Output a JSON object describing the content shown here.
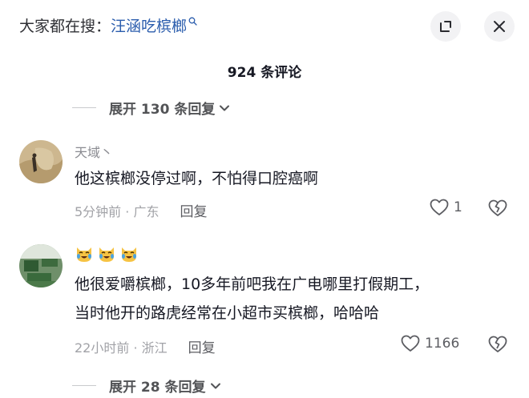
{
  "header": {
    "search_prefix": "大家都在搜：",
    "search_keyword": "汪涵吃槟榔"
  },
  "comments_title": "924 条评论",
  "thread1_expand": "展开 130 条回复",
  "comments": [
    {
      "author": "天域丶",
      "text": "他这槟榔没停过啊，不怕得口腔癌啊",
      "time_location": "5分钟前 · 广东",
      "reply_label": "回复",
      "likes": "1"
    },
    {
      "author_emojis": "😹😹😹",
      "text_line1": "他很爱嚼槟榔，10多年前吧我在广电哪里打假期工，",
      "text_line2": "当时他开的路虎经常在小超市买槟榔，哈哈哈",
      "time_location": "22小时前 · 浙江",
      "reply_label": "回复",
      "likes": "1166"
    }
  ],
  "thread2_expand": "展开 28 条回复",
  "colors": {
    "keyword": "#2b5dad",
    "text_primary": "#161823",
    "text_secondary": "#8a8b91",
    "button_bg": "#f2f2f4"
  },
  "icons": {
    "search": "search-icon",
    "expand": "expand-window-icon",
    "close": "close-icon",
    "chevron": "chevron-down-icon",
    "like": "heart-icon",
    "dislike": "broken-heart-icon"
  }
}
